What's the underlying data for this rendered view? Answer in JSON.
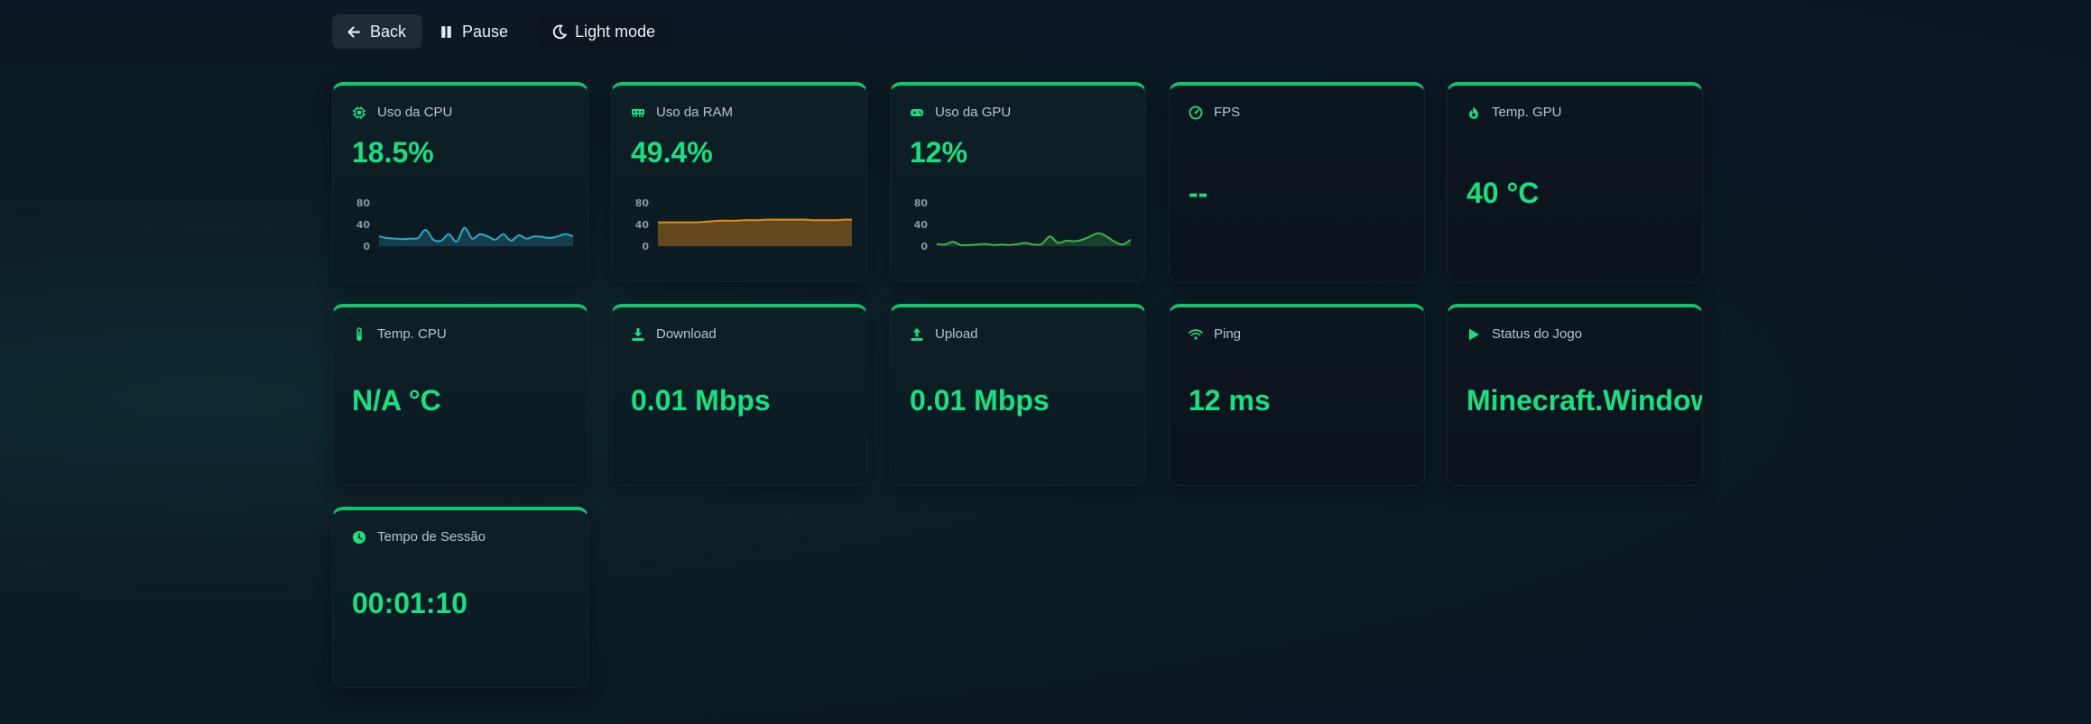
{
  "toolbar": {
    "back_label": "Back",
    "pause_label": "Pause",
    "theme_label": "Light mode"
  },
  "colors": {
    "accent": "#19e07f",
    "cpu_line": "#2aa9c9",
    "ram_line": "#e48b14",
    "gpu_line": "#3bb54a"
  },
  "cards": {
    "cpu": {
      "label": "Uso da CPU",
      "value": "18.5%",
      "icon": "cpu-chip-icon"
    },
    "ram": {
      "label": "Uso da RAM",
      "value": "49.4%",
      "icon": "memory-icon"
    },
    "gpu": {
      "label": "Uso da GPU",
      "value": "12%",
      "icon": "gamepad-icon"
    },
    "fps": {
      "label": "FPS",
      "value": "--",
      "icon": "gauge-icon"
    },
    "gpu_temp": {
      "label": "Temp. GPU",
      "value": "40 °C",
      "icon": "flame-icon"
    },
    "cpu_temp": {
      "label": "Temp. CPU",
      "value": "N/A °C",
      "icon": "thermometer-icon"
    },
    "download": {
      "label": "Download",
      "value": "0.01 Mbps",
      "icon": "download-icon"
    },
    "upload": {
      "label": "Upload",
      "value": "0.01 Mbps",
      "icon": "upload-icon"
    },
    "ping": {
      "label": "Ping",
      "value": "12 ms",
      "icon": "wifi-icon"
    },
    "game": {
      "label": "Status do Jogo",
      "value": "Minecraft.Windows",
      "icon": "play-icon"
    },
    "session": {
      "label": "Tempo de Sessão",
      "value": "00:01:10",
      "icon": "clock-icon"
    }
  },
  "chart_data": [
    {
      "type": "area",
      "name": "cpu",
      "ylim": [
        0,
        80
      ],
      "yticks": [
        "80",
        "40",
        "0"
      ],
      "values": [
        18,
        15,
        14,
        13,
        14,
        15,
        30,
        12,
        10,
        22,
        8,
        34,
        14,
        22,
        18,
        12,
        22,
        10,
        20,
        14,
        18,
        17,
        15,
        18,
        22,
        18
      ]
    },
    {
      "type": "area",
      "name": "ram",
      "ylim": [
        0,
        80
      ],
      "yticks": [
        "80",
        "40",
        "0"
      ],
      "values": [
        44,
        44,
        44,
        44,
        44,
        44,
        45,
        46,
        47,
        47,
        47,
        48,
        48,
        48,
        49,
        49,
        49,
        49,
        49,
        49,
        48,
        48,
        48,
        48,
        49,
        49
      ]
    },
    {
      "type": "area",
      "name": "gpu",
      "ylim": [
        0,
        80
      ],
      "yticks": [
        "80",
        "40",
        "0"
      ],
      "values": [
        4,
        3,
        8,
        2,
        2,
        3,
        4,
        2,
        3,
        2,
        4,
        6,
        3,
        4,
        18,
        6,
        10,
        9,
        12,
        18,
        24,
        18,
        8,
        3,
        12
      ]
    }
  ]
}
